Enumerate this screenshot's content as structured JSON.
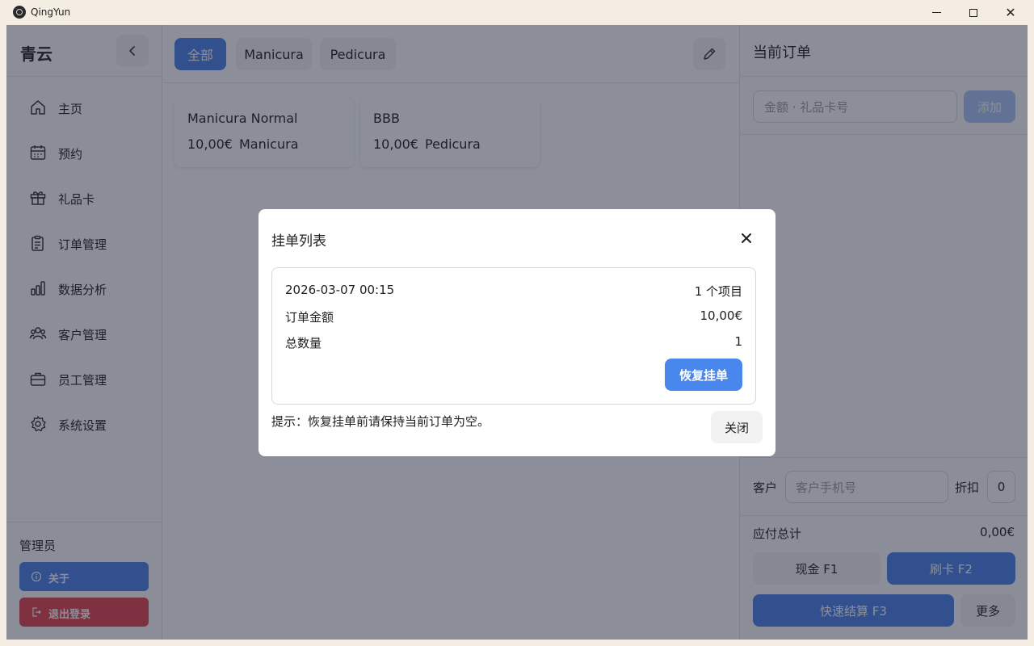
{
  "window": {
    "title": "QingYun",
    "minimize_icon": "minimize-icon",
    "maximize_icon": "maximize-icon",
    "close_glyph": "✕"
  },
  "sidebar": {
    "brand": "青云",
    "collapse_icon": "chevron-left-icon",
    "items": [
      {
        "label": "主页",
        "icon": "home-icon"
      },
      {
        "label": "预约",
        "icon": "calendar-icon"
      },
      {
        "label": "礼品卡",
        "icon": "gift-icon"
      },
      {
        "label": "订单管理",
        "icon": "clipboard-icon"
      },
      {
        "label": "数据分析",
        "icon": "bar-chart-icon"
      },
      {
        "label": "客户管理",
        "icon": "users-icon"
      },
      {
        "label": "员工管理",
        "icon": "briefcase-icon"
      },
      {
        "label": "系统设置",
        "icon": "gear-icon"
      }
    ],
    "user_role": "管理员",
    "about_label": "关于",
    "logout_label": "退出登录"
  },
  "categories": {
    "tabs": [
      "全部",
      "Manicura",
      "Pedicura"
    ],
    "active": "全部"
  },
  "products": [
    {
      "name": "Manicura Normal",
      "price": "10,00€",
      "category": "Manicura"
    },
    {
      "name": "BBB",
      "price": "10,00€",
      "category": "Pedicura"
    }
  ],
  "order": {
    "title": "当前订单",
    "gift_placeholder": "金额 · 礼品卡号",
    "add_label": "添加",
    "customer_label": "客户",
    "customer_placeholder": "客户手机号",
    "discount_label": "折扣",
    "discount_value": "0",
    "total_label": "应付总计",
    "total_value": "0,00€",
    "cash_label": "现金  F1",
    "card_label": "刷卡  F2",
    "quick_label": "快速结算  F3",
    "more_label": "更多"
  },
  "modal": {
    "title": "挂单列表",
    "held": {
      "datetime": "2026-03-07 00:15",
      "items_count": "1 个项目",
      "amount_label": "订单金额",
      "amount_value": "10,00€",
      "qty_label": "总数量",
      "qty_value": "1",
      "restore_label": "恢复挂单"
    },
    "hint": "提示：恢复挂单前请保持当前订单为空。",
    "close_label": "关闭"
  },
  "colors": {
    "accent": "#4a7fe8",
    "danger": "#e0424e",
    "overlay": "#192034"
  }
}
